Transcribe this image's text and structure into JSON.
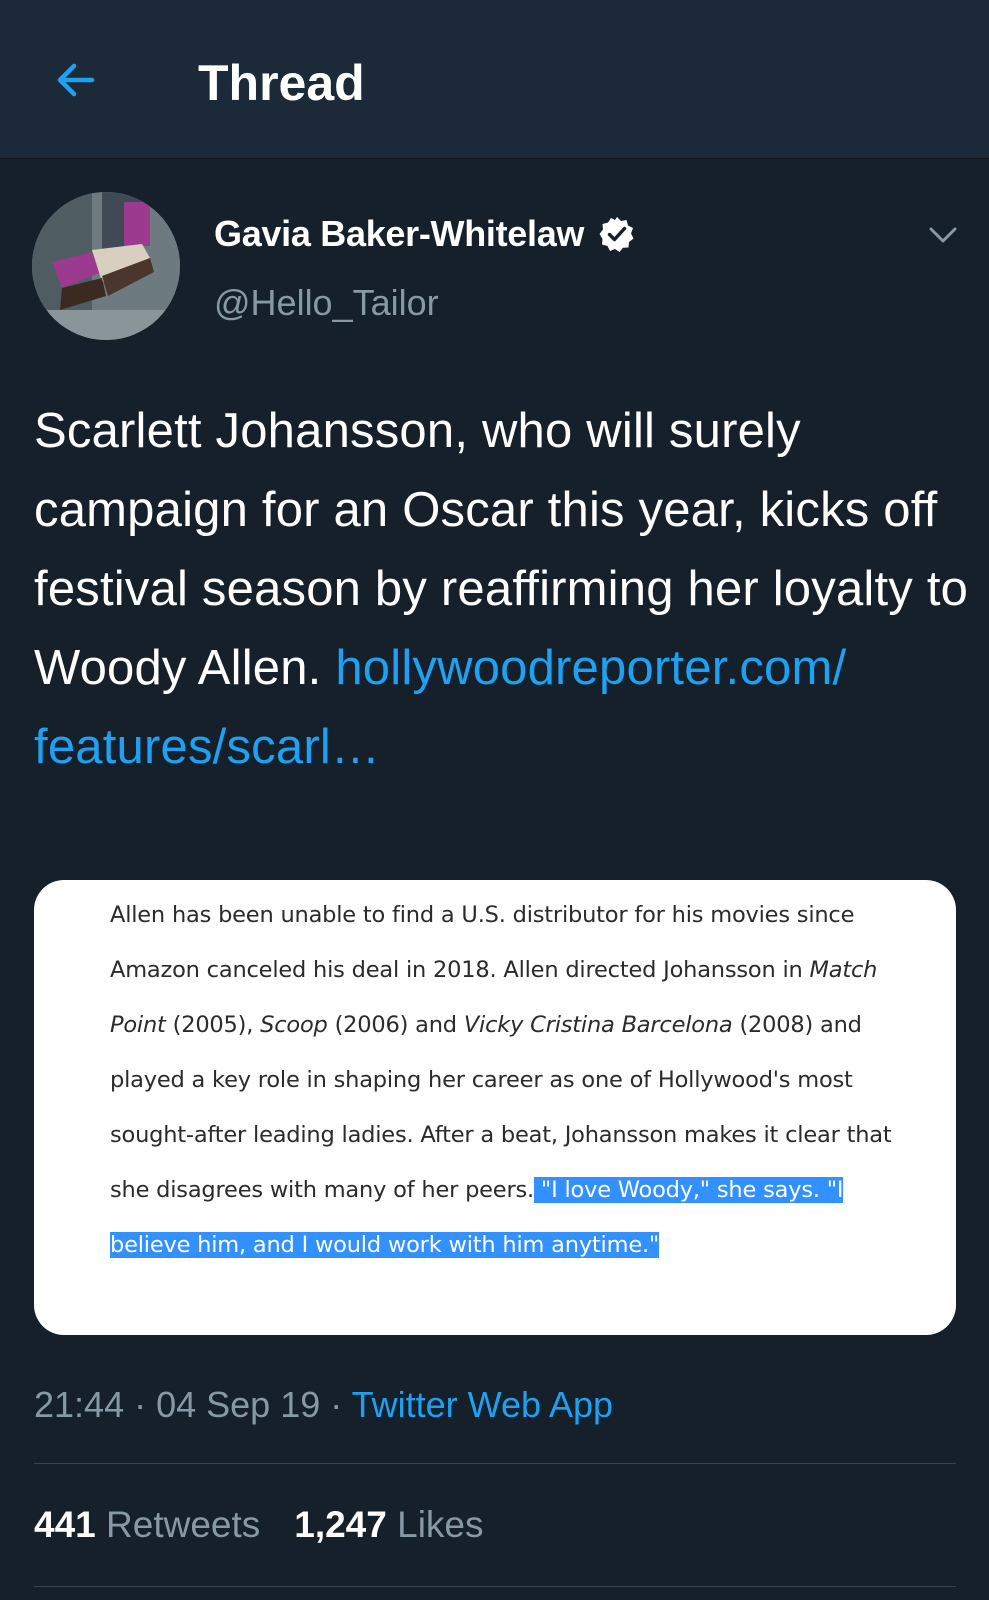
{
  "header": {
    "back_icon": "arrow-left-icon",
    "title": "Thread"
  },
  "tweet": {
    "author_name": "Gavia Baker-Whitelaw",
    "verified_icon": "verified-badge-icon",
    "handle": "@Hello_Tailor",
    "menu_icon": "chevron-down-icon",
    "text": "Scarlett Johansson, who will surely campaign for an Oscar this year, kicks off festival season by reaffirming her loyalty to Woody Allen.",
    "link_line1": "hollywoodreporter.com/",
    "link_line2": "features/scarl…",
    "card": {
      "seg1": "Allen has been unable to find a U.S. distributor for his movies since Amazon canceled his deal in 2018. Allen directed Johansson in ",
      "film1": "Match Point",
      "seg2": " (2005), ",
      "film2": "Scoop",
      "seg3": " (2006) and ",
      "film3": "Vicky Cristina Barcelona",
      "seg4": " (2008) and played a key role in shaping her career as one of Hollywood's most sought-after leading ladies. After a beat, Johansson makes it clear that she disagrees with many of her peers.",
      "highlight": " \"I love Woody,\" she says. \"I believe him, and I would work with him anytime.\""
    },
    "time": "21:44",
    "date": "04 Sep 19",
    "source": "Twitter Web App",
    "retweets_count": "441",
    "retweets_label": "Retweets",
    "likes_count": "1,247",
    "likes_label": "Likes"
  },
  "colors": {
    "background": "#15202b",
    "header": "#1c2938",
    "accent": "#1da1f2",
    "secondary_text": "#8899a6",
    "highlight": "#3390ff"
  }
}
